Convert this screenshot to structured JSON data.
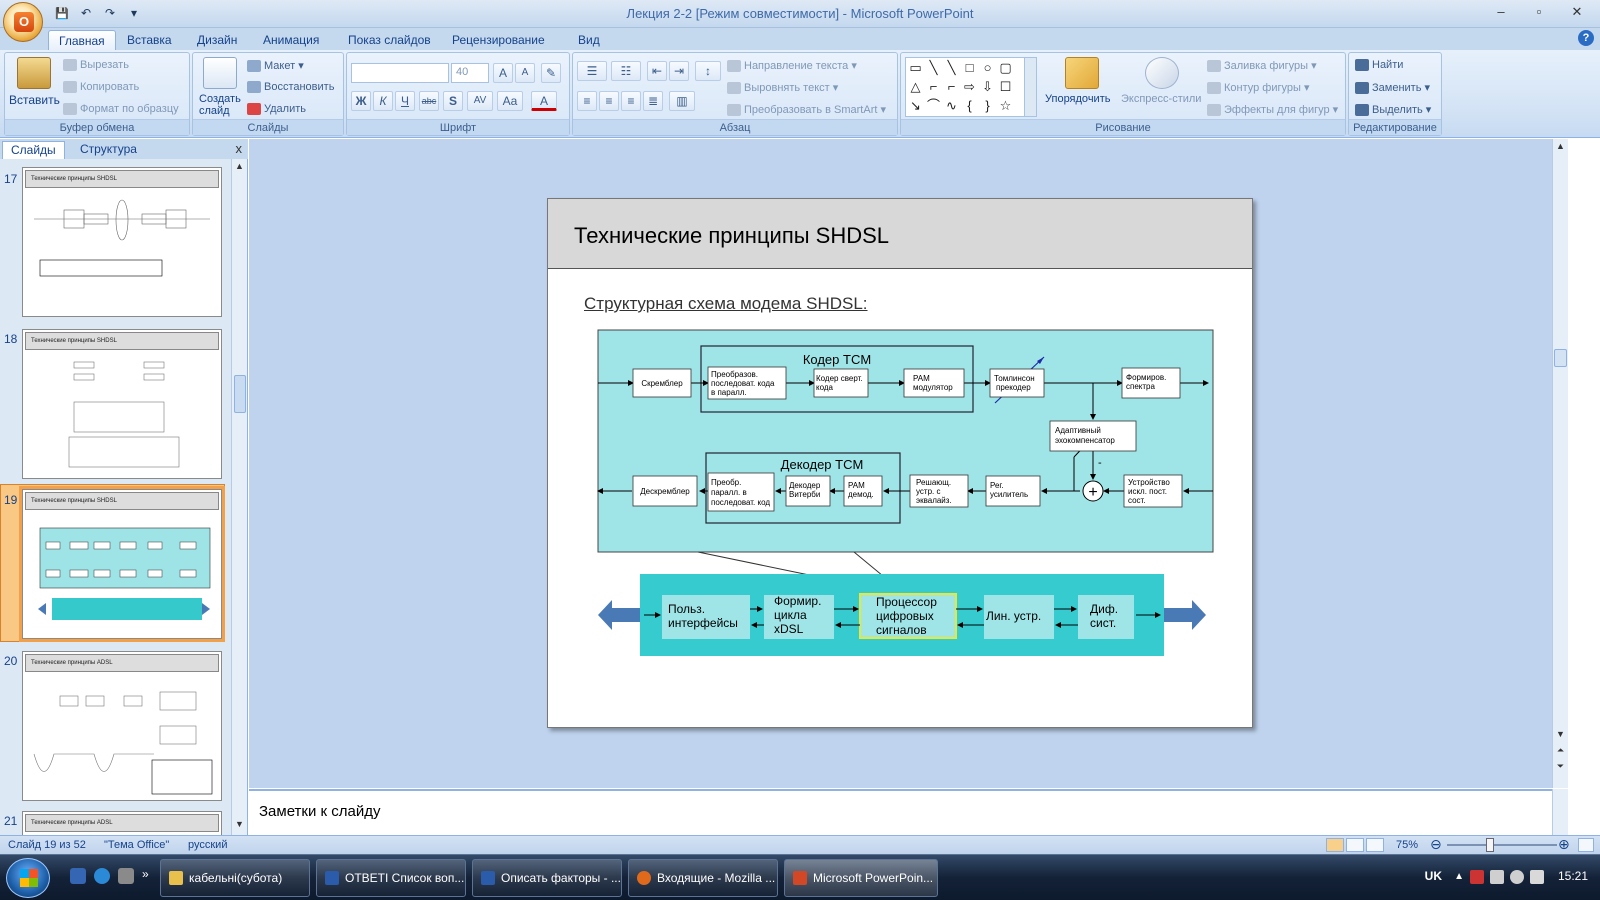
{
  "window": {
    "title": "Лекция 2-2 [Режим совместимости] - Microsoft PowerPoint",
    "office_logo": "O",
    "controls": {
      "minimize": "–",
      "maximize": "▫",
      "close": "✕"
    }
  },
  "qat": {
    "save": "💾",
    "undo": "↶",
    "redo": "↷",
    "customize": "▾"
  },
  "tabs": [
    "Главная",
    "Вставка",
    "Дизайн",
    "Анимация",
    "Показ слайдов",
    "Рецензирование",
    "Вид"
  ],
  "help": "?",
  "ribbon": {
    "clipboard": {
      "label": "Буфер обмена",
      "paste": "Вставить",
      "cut": "Вырезать",
      "copy": "Копировать",
      "format_painter": "Формат по образцу"
    },
    "slides": {
      "label": "Слайды",
      "new_slide": "Создать слайд",
      "layout": "Макет",
      "reset": "Восстановить",
      "delete": "Удалить"
    },
    "font": {
      "label": "Шрифт",
      "font_name": "",
      "font_size": "40",
      "grow": "A",
      "shrink": "A",
      "clear": "✎",
      "bold": "Ж",
      "italic": "К",
      "underline": "Ч",
      "strike": "abc",
      "shadow": "S",
      "spacing": "AV",
      "case": "Aa",
      "color": "A"
    },
    "paragraph": {
      "label": "Абзац",
      "text_direction": "Направление текста",
      "align_text": "Выровнять текст",
      "smartart": "Преобразовать в SmartArt"
    },
    "drawing": {
      "label": "Рисование",
      "arrange": "Упорядочить",
      "quick_styles": "Экспресс-стили",
      "fill": "Заливка фигуры",
      "outline": "Контур фигуры",
      "effects": "Эффекты для фигур"
    },
    "editing": {
      "label": "Редактирование",
      "find": "Найти",
      "replace": "Заменить",
      "select": "Выделить"
    }
  },
  "left_pane": {
    "tab_slides": "Слайды",
    "tab_outline": "Структура",
    "close": "x",
    "thumbnails": [
      {
        "num": "17",
        "title": "Технические принципы SHDSL"
      },
      {
        "num": "18",
        "title": "Технические принципы SHDSL"
      },
      {
        "num": "19",
        "title": "Технические принципы SHDSL"
      },
      {
        "num": "20",
        "title": "Технические принципы ADSL"
      },
      {
        "num": "21",
        "title": "Технические принципы ADSL"
      }
    ]
  },
  "slide": {
    "title": "Технические принципы SHDSL",
    "subtitle": "Структурная схема модема SHDSL:",
    "diagram": {
      "coder_label": "Кодер TCM",
      "decoder_label": "Декодер TCM",
      "top_row": {
        "scrambler": "Скремблер",
        "converter": [
          "Преобразов.",
          "последоват. кода",
          "в паралл."
        ],
        "conv_coder": [
          "Кодер сверт.",
          "кода"
        ],
        "pam_mod": [
          "PAM",
          "модулятор"
        ],
        "tomlinson": [
          "Томлинсон",
          "прекодер"
        ],
        "spectrum": [
          "Формиров.",
          "спектра"
        ]
      },
      "echo": [
        "Адаптивный",
        "эхокомпенсатор"
      ],
      "minus_sign": "-",
      "sum_sign": "+",
      "bottom_row": {
        "descrambler": "Дескремблер",
        "par_to_ser": [
          "Преобр.",
          "паралл. в",
          "последоват. код"
        ],
        "viterbi": [
          "Декодер",
          "Витерби"
        ],
        "pam_demod": [
          "PAM",
          "демод."
        ],
        "decision": [
          "Решающ.",
          "устр. с",
          "эквалайз."
        ],
        "reg_amp": [
          "Рег.",
          "усилитель"
        ],
        "dc_removal": [
          "Устройство",
          "искл. пост.",
          "сост."
        ]
      },
      "lower": {
        "user_if": [
          "Польз.",
          "интерфейсы"
        ],
        "framing": [
          "Формир.",
          "цикла",
          "xDSL"
        ],
        "dsp": [
          "Процессор",
          "цифровых",
          "сигналов"
        ],
        "line_dev": [
          "Лин. устр."
        ],
        "diff_sys": [
          "Диф.",
          "сист."
        ]
      }
    }
  },
  "notes": {
    "placeholder": "Заметки к слайду"
  },
  "status": {
    "slide_counter": "Слайд 19 из 52",
    "theme": "\"Тема Office\"",
    "language": "русский",
    "zoom": "75%",
    "zoom_out": "⊖",
    "zoom_in": "⊕"
  },
  "taskbar": {
    "items": [
      {
        "label": "кабельні(субота)",
        "color": "#e8c04b"
      },
      {
        "label": "ОТВЕТІ Список воп...",
        "color": "#2a5cab"
      },
      {
        "label": "Описать факторы - ...",
        "color": "#2a5cab"
      },
      {
        "label": "Входящие - Mozilla ...",
        "color": "#e06a1b"
      },
      {
        "label": "Microsoft PowerPoin...",
        "color": "#d24726"
      }
    ],
    "lang": "UK",
    "clock": "15:21",
    "more": "»"
  }
}
